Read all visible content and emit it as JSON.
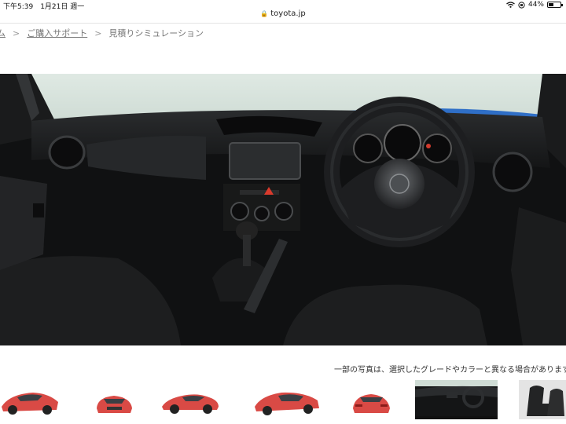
{
  "status_bar": {
    "time_date": "下午5:39　1月21日 週一",
    "battery": "44%",
    "battery_level": 0.44,
    "icons": [
      "wifi-icon",
      "orientation-lock-icon"
    ]
  },
  "address_bar": {
    "domain": "toyota.jp",
    "icon": "lock-icon"
  },
  "breadcrumb": {
    "items": [
      {
        "label": "ム"
      },
      {
        "label": "ご購入サポート"
      },
      {
        "label": "見積りシミュレーション"
      }
    ],
    "separator": ">"
  },
  "hero_image": {
    "subject": "car-interior-dashboard"
  },
  "disclaimer": "一部の写真は、選択したグレードやカラーと異なる場合があります",
  "thumbnails": [
    {
      "view": "front-left-exterior"
    },
    {
      "view": "front-exterior"
    },
    {
      "view": "side-exterior"
    },
    {
      "view": "rear-left-exterior"
    },
    {
      "view": "rear-exterior"
    },
    {
      "view": "dashboard-interior",
      "selected": true
    },
    {
      "view": "seat-interior"
    }
  ],
  "colors": {
    "body_color": "#d94a45",
    "accent_blue": "#2f6fc7"
  }
}
